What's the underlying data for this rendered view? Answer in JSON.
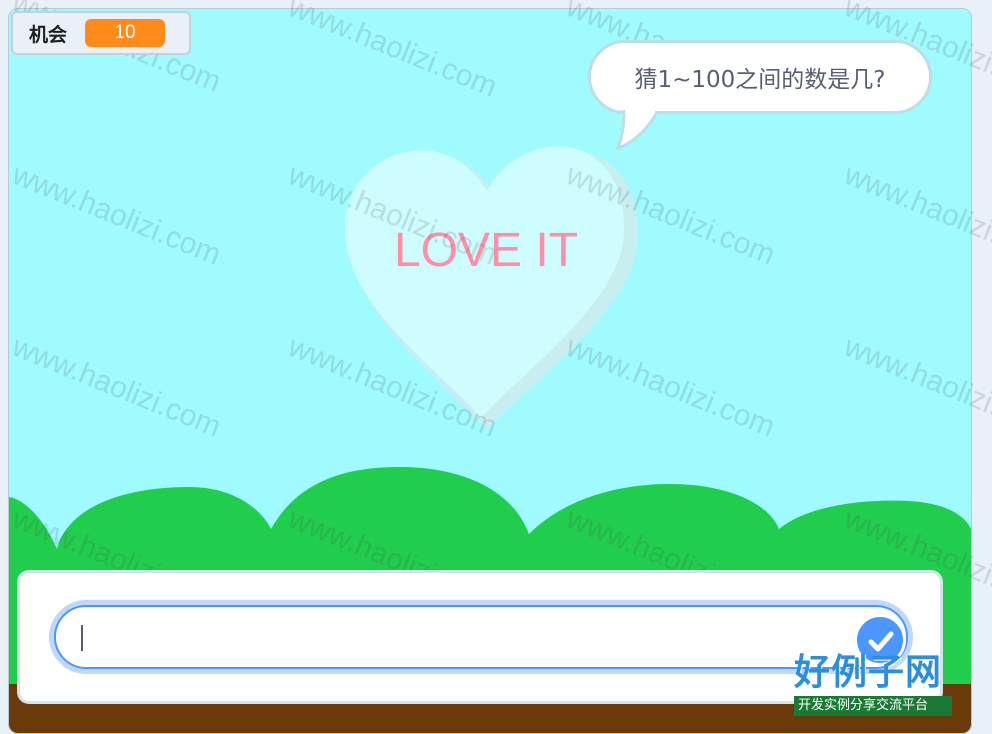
{
  "monitor": {
    "label": "机会",
    "value": "10"
  },
  "speech": {
    "text": "猜1~100之间的数是几?"
  },
  "sprite": {
    "text": "LOVE IT"
  },
  "ask": {
    "input_value": ""
  },
  "watermark": {
    "text": "www.haolizi.com"
  },
  "logo": {
    "main": "好例子网",
    "sub": "开发实例分享交流平台"
  },
  "colors": {
    "sky": "#9ffbfd",
    "hills": "#21cd4d",
    "ground": "#6b3a0b",
    "monitor_value_bg": "#ff8c1a",
    "input_border": "#4c97ff",
    "heart_text": "#ff8fa6"
  },
  "icons": {
    "submit": "check-icon"
  }
}
